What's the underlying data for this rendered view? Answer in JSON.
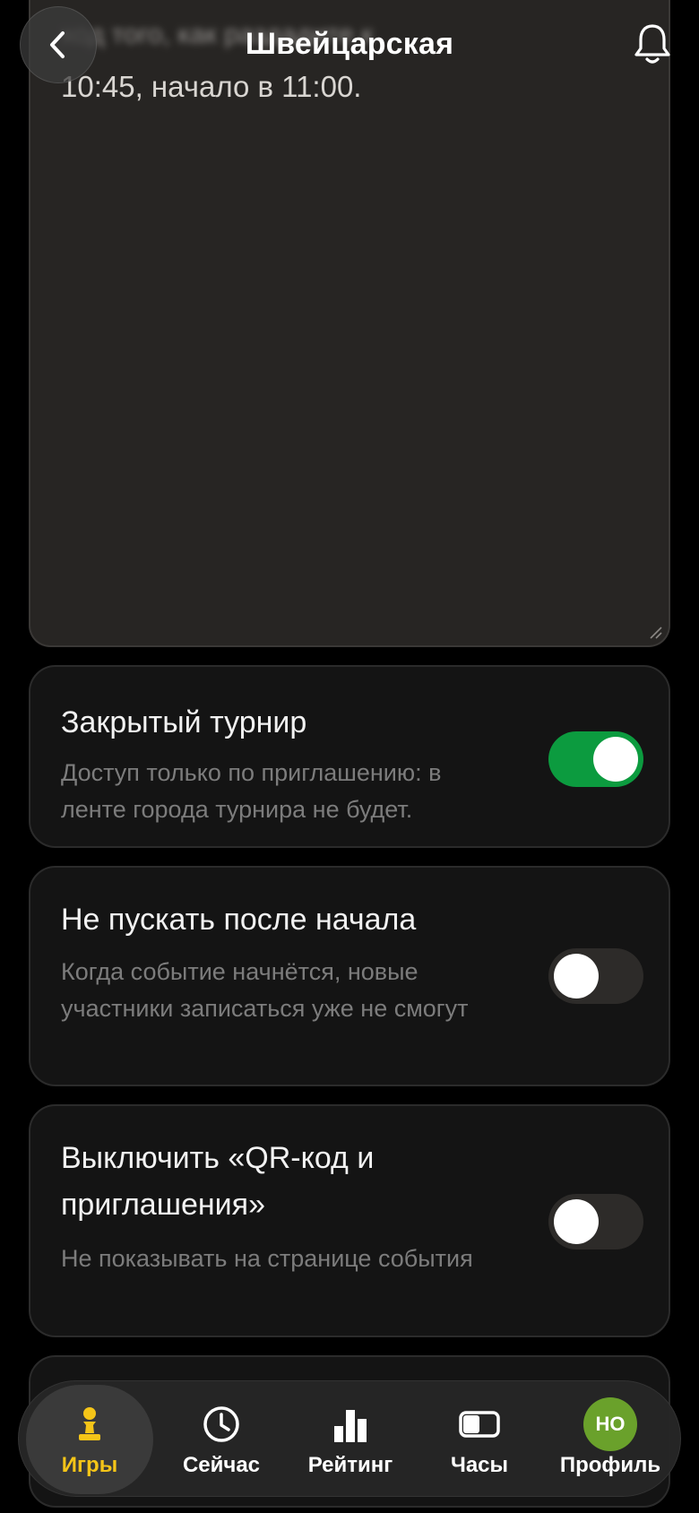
{
  "header": {
    "title": "Швейцарская",
    "back_icon": "chevron-left-icon",
    "bell_icon": "bell-icon"
  },
  "description": {
    "partial_line": "ход того, как раздадите к",
    "visible_line": "10:45, начало в 11:00."
  },
  "settings": [
    {
      "title": "Закрытый турнир",
      "desc": "Доступ только по приглашению: в ленте города турнира не будет.",
      "enabled": true
    },
    {
      "title": "Не пускать после начала",
      "desc": "Когда событие начнётся, новые участники записаться уже не смогут",
      "enabled": false
    },
    {
      "title": "Выключить «QR-код и приглашения»",
      "desc": "Не показывать на странице события",
      "enabled": false
    }
  ],
  "nav": {
    "items": [
      {
        "label": "Игры",
        "icon": "pawn-icon",
        "active": true
      },
      {
        "label": "Сейчас",
        "icon": "clock-icon",
        "active": false
      },
      {
        "label": "Рейтинг",
        "icon": "bar-chart-icon",
        "active": false
      },
      {
        "label": "Часы",
        "icon": "chess-clock-icon",
        "active": false
      },
      {
        "label": "Профиль",
        "icon": "avatar",
        "active": false
      }
    ],
    "avatar_initials": "НО"
  },
  "colors": {
    "accent_green": "#0c9b3f",
    "active_yellow": "#f5c518",
    "avatar_green": "#6aa12b"
  }
}
